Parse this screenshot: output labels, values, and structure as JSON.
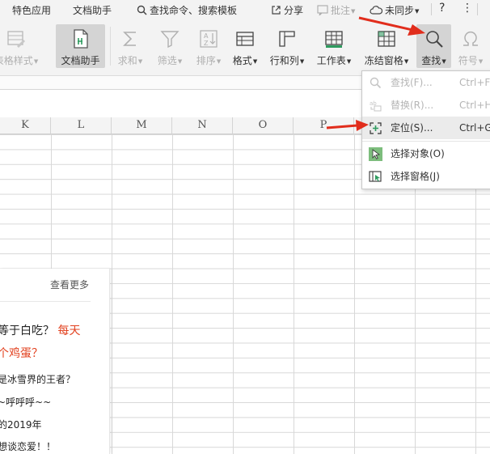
{
  "menubar": {
    "special_apps": "特色应用",
    "doc_assistant": "文档助手",
    "search_commands": "查找命令、搜索模板",
    "share": "分享",
    "annotate": "批注",
    "not_synced": "未同步",
    "help": "?",
    "more": "⋮"
  },
  "ribbon": {
    "table_style": "表格样式",
    "doc_assistant": "文档助手",
    "sum": "求和",
    "filter": "筛选",
    "sort": "排序",
    "format": "格式",
    "rows_cols": "行和列",
    "worksheet": "工作表",
    "freeze_panes": "冻结窗格",
    "find": "查找",
    "symbol": "符号"
  },
  "columns": [
    "K",
    "L",
    "M",
    "N",
    "O",
    "P"
  ],
  "dropdown": {
    "items": [
      {
        "label": "查找(F)...",
        "shortcut": "Ctrl+F",
        "enabled": false
      },
      {
        "label": "替换(R)...",
        "shortcut": "Ctrl+H",
        "enabled": false
      },
      {
        "label": "定位(S)...",
        "shortcut": "Ctrl+G",
        "enabled": true
      },
      {
        "label": "选择对象(O)",
        "shortcut": "",
        "enabled": true
      },
      {
        "label": "选择窗格(J)",
        "shortcut": "",
        "enabled": true
      }
    ]
  },
  "news": {
    "more_link": "查看更多",
    "line1_a": "等于白吃？",
    "line1_b": "每天",
    "line2": "个鸡蛋？",
    "line3": "是冰雪界的王者？",
    "line4": "~呼呼呼~~",
    "line5": "的2019年",
    "line6": "想谈恋爱！！"
  },
  "colors": {
    "accent_red": "#e2411f",
    "menu_bg": "#f3f3f3",
    "active_button": "#d4d4d4"
  }
}
